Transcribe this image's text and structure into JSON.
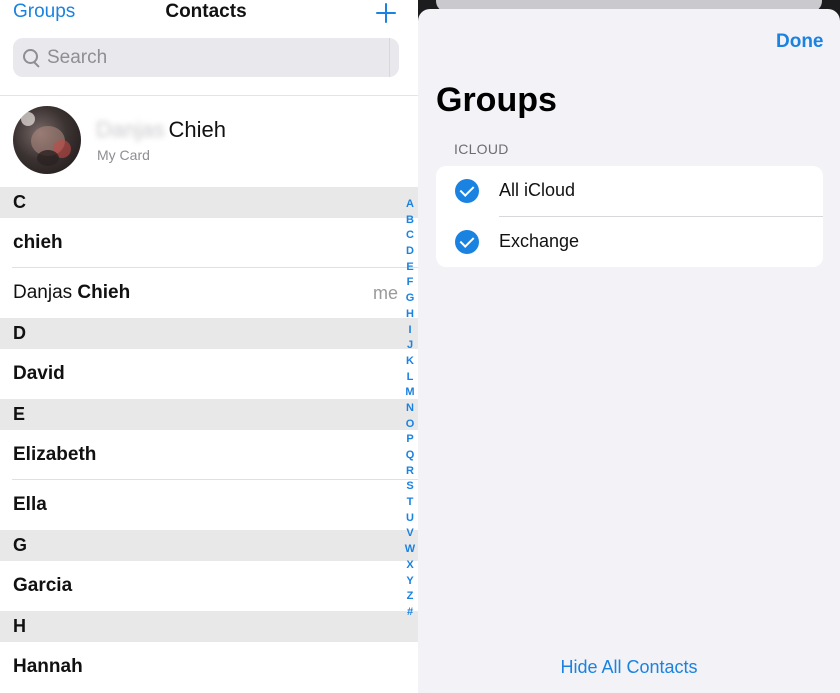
{
  "contacts": {
    "nav": {
      "groups_label": "Groups",
      "title": "Contacts",
      "add_icon": "plus-icon"
    },
    "search": {
      "placeholder": "Search",
      "icon": "magnifier-icon"
    },
    "my_card": {
      "first_name": "Danjas",
      "last_name": "Chieh",
      "subtitle": "My Card"
    },
    "sections": [
      {
        "letter": "C",
        "rows": [
          {
            "parts": [
              {
                "text": "chieh",
                "bold": true
              }
            ],
            "badge": ""
          },
          {
            "parts": [
              {
                "text": "Danjas ",
                "bold": false
              },
              {
                "text": "Chieh",
                "bold": true
              }
            ],
            "badge": "me"
          }
        ]
      },
      {
        "letter": "D",
        "rows": [
          {
            "parts": [
              {
                "text": "David",
                "bold": true
              }
            ],
            "badge": ""
          }
        ]
      },
      {
        "letter": "E",
        "rows": [
          {
            "parts": [
              {
                "text": "Elizabeth",
                "bold": true
              }
            ],
            "badge": ""
          },
          {
            "parts": [
              {
                "text": "Ella",
                "bold": true
              }
            ],
            "badge": ""
          }
        ]
      },
      {
        "letter": "G",
        "rows": [
          {
            "parts": [
              {
                "text": "Garcia",
                "bold": true
              }
            ],
            "badge": ""
          }
        ]
      },
      {
        "letter": "H",
        "rows": [
          {
            "parts": [
              {
                "text": "Hannah",
                "bold": true
              }
            ],
            "badge": ""
          }
        ]
      }
    ],
    "index_letters": [
      "A",
      "B",
      "C",
      "D",
      "E",
      "F",
      "G",
      "H",
      "I",
      "J",
      "K",
      "L",
      "M",
      "N",
      "O",
      "P",
      "Q",
      "R",
      "S",
      "T",
      "U",
      "V",
      "W",
      "X",
      "Y",
      "Z",
      "#"
    ]
  },
  "groups_sheet": {
    "done_label": "Done",
    "title": "Groups",
    "section_label": "ICLOUD",
    "items": [
      {
        "label": "All iCloud",
        "checked": true
      },
      {
        "label": "Exchange",
        "checked": true
      }
    ],
    "hide_all_label": "Hide All Contacts"
  },
  "colors": {
    "accent": "#1a82e0",
    "section_header_bg": "#e8e8e8",
    "sheet_bg": "#f2f2f7"
  }
}
